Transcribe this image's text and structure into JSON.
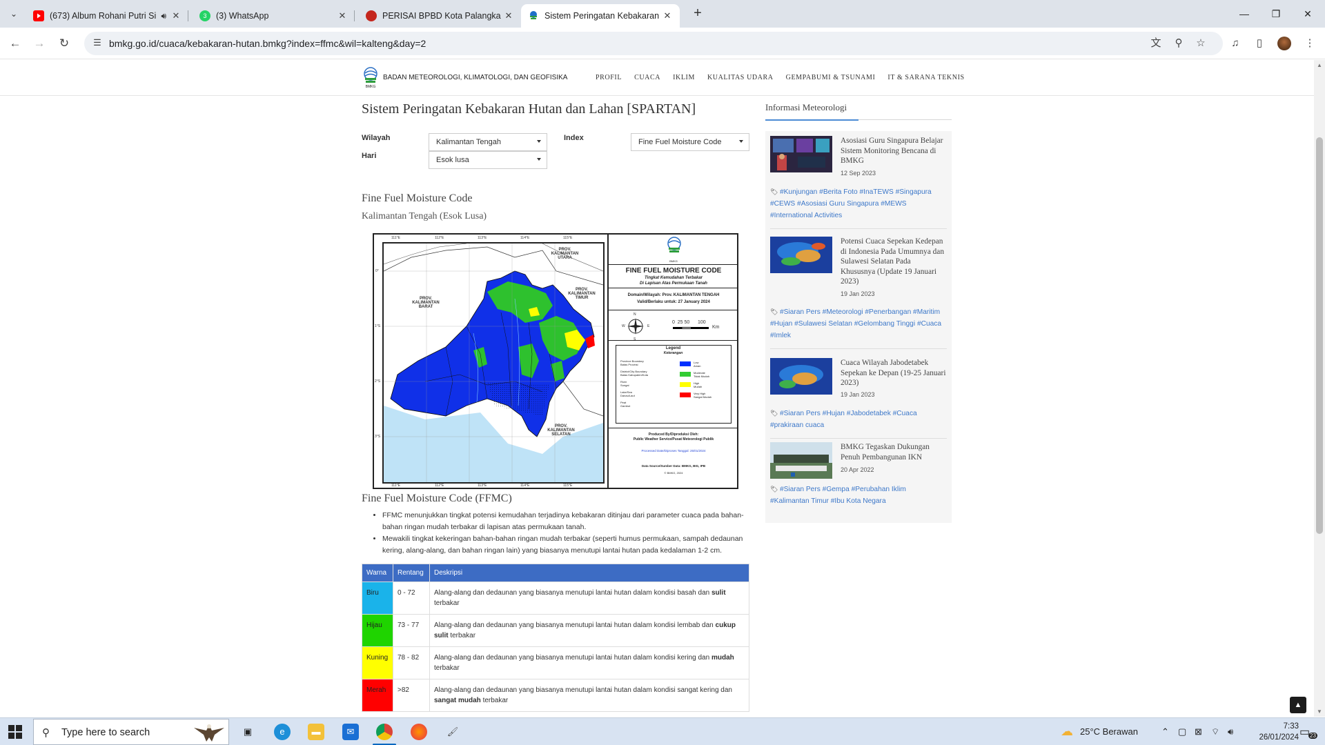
{
  "browser": {
    "tabs": [
      {
        "title": "(673) Album Rohani Putri Si",
        "icon": "youtube-icon",
        "audio": true
      },
      {
        "title": "(3) WhatsApp",
        "icon": "whatsapp-icon"
      },
      {
        "title": "PERISAI BPBD Kota Palangka Ra",
        "icon": "bpbd-icon"
      },
      {
        "title": "Sistem Peringatan Kebakaran H",
        "icon": "bmkg-icon",
        "active": true
      }
    ],
    "url": "bmkg.go.id/cuaca/kebakaran-hutan.bmkg?index=ffmc&wil=kalteng&day=2"
  },
  "site": {
    "brand": "BADAN METEOROLOGI, KLIMATOLOGI, DAN GEOFISIKA",
    "menu": [
      "PROFIL",
      "CUACA",
      "IKLIM",
      "KUALITAS UDARA",
      "GEMPABUMI & TSUNAMI",
      "IT & SARANA TEKNIS"
    ]
  },
  "page": {
    "title": "Sistem Peringatan Kebakaran Hutan dan Lahan [SPARTAN]",
    "filters": {
      "wilayah_label": "Wilayah",
      "wilayah_value": "Kalimantan Tengah",
      "hari_label": "Hari",
      "hari_value": "Esok lusa",
      "index_label": "Index",
      "index_value": "Fine Fuel Moisture Code"
    },
    "section_title": "Fine Fuel Moisture Code",
    "section_subtitle": "Kalimantan Tengah (Esok Lusa)",
    "map": {
      "logo_text": "BMKG",
      "title": "FINE FUEL MOISTURE CODE",
      "subtitle1": "Tingkat Kemudahan Terbakar",
      "subtitle2": "Di Lapisan Atas Permukaan Tanah",
      "domain": "Domain/Wilayah: Prov. KALIMANTAN TENGAH",
      "valid": "Valid/Berlaku untuk: 27 January 2024",
      "scale_nums": "0  25 50      100",
      "scale_unit": "Km",
      "compass": {
        "n": "N",
        "s": "S",
        "e": "E",
        "w": "W"
      },
      "legend_title": "Legend",
      "legend_subtitle": "Keterangan",
      "legend_left": [
        "Province Boundary",
        "Batas Provinsi",
        "District/City Boundary",
        "Batas Kabupaten/Kota",
        "River",
        "Sungai",
        "Lake/Sea",
        "Danau/Laut",
        "Peat",
        "Gambut"
      ],
      "legend_right": [
        {
          "en": "Low",
          "id": "Aman",
          "color": "#0030ff"
        },
        {
          "en": "Moderate",
          "id": "Tidak Mudah",
          "color": "#33cc33"
        },
        {
          "en": "High",
          "id": "Mudah",
          "color": "#ffff00"
        },
        {
          "en": "Very High",
          "id": "Sangat Mudah",
          "color": "#ff0000"
        }
      ],
      "produced1": "Produced By/Diproduksi Oleh:",
      "produced2": "Public Weather Service/Pusat Meteorologi Publik",
      "processed": "Processed Date/Diproses Tanggal: 25/01/2024",
      "source": "Data Source/Sumber Data: BMKG, BIG, IPB",
      "copyright": "© BMKG, 2024",
      "prov_labels": [
        "PROV. KALIMANTAN UTARA",
        "PROV. KALIMANTAN BARAT",
        "PROV. KALIMANTAN TIMUR",
        "PROV. KALIMANTAN SELATAN"
      ],
      "lon_ticks": [
        "111°E",
        "112°E",
        "113°E",
        "114°E",
        "115°E"
      ],
      "lat_ticks": [
        "0°",
        "1°S",
        "2°S",
        "3°S"
      ]
    },
    "ffmc_heading": "Fine Fuel Moisture Code (FFMC)",
    "bullets": [
      "FFMC menunjukkan tingkat potensi kemudahan terjadinya kebakaran ditinjau dari parameter cuaca pada bahan-bahan ringan mudah terbakar di lapisan atas permukaan tanah.",
      "Mewakili tingkat kekeringan bahan-bahan ringan mudah terbakar (seperti humus permukaan, sampah dedaunan kering, alang-alang, dan bahan ringan lain) yang biasanya menutupi lantai hutan pada kedalaman 1-2 cm."
    ],
    "table": {
      "headers": [
        "Warna",
        "Rentang",
        "Deskripsi"
      ],
      "rows": [
        {
          "color_name": "Biru",
          "color": "#1ab3ea",
          "range": "0 - 72",
          "desc_pre": "Alang-alang dan dedaunan yang biasanya menutupi lantai hutan dalam kondisi basah dan ",
          "desc_bold": "sulit",
          "desc_post": " terbakar"
        },
        {
          "color_name": "Hijau",
          "color": "#1fd400",
          "range": "73 - 77",
          "desc_pre": "Alang-alang dan dedaunan yang biasanya menutupi lantai hutan dalam kondisi lembab dan ",
          "desc_bold": "cukup sulit",
          "desc_post": " terbakar"
        },
        {
          "color_name": "Kuning",
          "color": "#ffff00",
          "range": "78 - 82",
          "desc_pre": "Alang-alang dan dedaunan yang biasanya menutupi lantai hutan dalam kondisi kering dan ",
          "desc_bold": "mudah",
          "desc_post": " terbakar"
        },
        {
          "color_name": "Merah",
          "color": "#ff0000",
          "range": ">82",
          "desc_pre": "Alang-alang dan dedaunan yang biasanya menutupi lantai hutan dalam kondisi sangat kering dan ",
          "desc_bold": "sangat mudah",
          "desc_post": " terbakar"
        }
      ]
    }
  },
  "sidebar": {
    "title": "Informasi Meteorologi",
    "news": [
      {
        "title": "Asosiasi Guru Singapura Belajar Sistem Monitoring Bencana di BMKG",
        "date": "12 Sep 2023",
        "tags": "#Kunjungan #Berita Foto #InaTEWS #Singapura #CEWS #Asosiasi Guru Singapura #MEWS #International Activities"
      },
      {
        "title": "Potensi Cuaca Sepekan Kedepan di Indonesia Pada Umumnya dan Sulawesi Selatan Pada Khususnya (Update 19 Januari 2023)",
        "date": "19 Jan 2023",
        "tags": "#Siaran Pers #Meteorologi #Penerbangan #Maritim #Hujan #Sulawesi Selatan #Gelombang Tinggi #Cuaca #Imlek"
      },
      {
        "title": "Cuaca Wilayah Jabodetabek Sepekan ke Depan (19-25 Januari 2023)",
        "date": "19 Jan 2023",
        "tags": "#Siaran Pers #Hujan #Jabodetabek #Cuaca #prakiraan cuaca"
      },
      {
        "title": "BMKG Tegaskan Dukungan Penuh Pembangunan IKN",
        "date": "20 Apr 2022",
        "tags": "#Siaran Pers #Gempa #Perubahan Iklim #Kalimantan Timur #Ibu Kota Negara"
      }
    ]
  },
  "taskbar": {
    "search_placeholder": "Type here to search",
    "weather": "25°C  Berawan",
    "time": "7:33",
    "date": "26/01/2024",
    "notif_count": "23"
  }
}
